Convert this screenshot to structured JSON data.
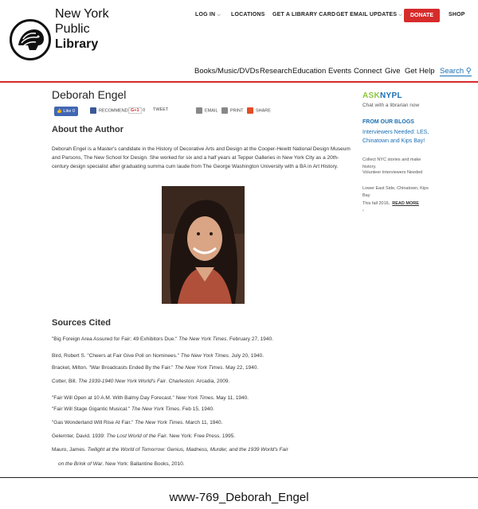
{
  "brand": {
    "line1": "New York",
    "line2": "Public",
    "line3": "Library"
  },
  "topnav": {
    "login": "LOG IN",
    "locations": "LOCATIONS",
    "library_card": "GET A LIBRARY CARD",
    "email_updates": "GET EMAIL UPDATES",
    "donate": "DONATE",
    "shop": "SHOP"
  },
  "mainnav": {
    "items": [
      "Books/Music/DVDs",
      "Research",
      "Education",
      "Events",
      "Connect",
      "Give",
      "Get Help"
    ],
    "search": "Search"
  },
  "page": {
    "title": "Deborah Engel",
    "share": {
      "like": "Like 0",
      "recommend": "RECOMMEND",
      "gplus": "G+1",
      "gplus_count": "0",
      "tweet": "TWEET",
      "email": "EMAIL",
      "print": "PRINT",
      "share": "SHARE"
    },
    "about_heading": "About the Author",
    "bio": "Deborah Engel is a Master's candidate in the History of Decorative Arts and Design at the Cooper-Hewitt National Design Museum and Parsons, The New School for Design. She worked for six and a half years at Tepper Galleries in New York City as a 20th-century design specialist after graduating summa cum laude from The George Washington University with a BA in Art History.",
    "sources_heading": "Sources Cited",
    "sources": [
      {
        "pre": "\"Big Foreign Area Assured for Fair; 49 Exhibitors Due.\" ",
        "italic": "The New York Times",
        "post": ". February 27, 1940."
      },
      {
        "pre": "Bird, Robert S. \"Cheers at Fair Give Poll on Nominees.\" ",
        "italic": "The New York Times",
        "post": ". July 20, 1940."
      },
      {
        "pre": "Bracket, Milton. \"War Broadcasts Ended By the Fair.\" ",
        "italic": "The New York Times",
        "post": ". May 22, 1940."
      },
      {
        "pre": "Cotter, Bill. ",
        "italic": "The 1939-1940 New York World's Fair",
        "post": ". Charleston: Arcadia, 2009."
      },
      {
        "pre": "\"Fair Will Open at 10 A.M. With Balmy Day Forecast.\" ",
        "italic": "New York Times",
        "post": ". May 11, 1940."
      },
      {
        "pre": "\"Fair Will Stage Gigantic Musical.\" ",
        "italic": "The New York Times",
        "post": ". Feb 15, 1940."
      },
      {
        "pre": "\"Gas Wonderland Will Rise At Fair.\" ",
        "italic": "The New York Times",
        "post": ". March 11, 1940."
      },
      {
        "pre": "Gelernter, David. 1939: ",
        "italic": "The Lost World of the Fair",
        "post": ". New York: Free Press. 1995."
      },
      {
        "pre": "Mauro, James. ",
        "italic": "Twilight at the World of Tomorrow: Genius, Madness, Murder, and the 1939 World's Fair",
        "post": ""
      },
      {
        "pre": "",
        "italic": "on the Brink of War",
        "post": ". New York: Ballantine  Books, 2010."
      }
    ]
  },
  "sidebar": {
    "ask_part1": "ASK",
    "ask_part2": "NYPL",
    "ask_sub": "Chat with a librarian now",
    "blogs_heading": "FROM OUR BLOGS",
    "blog_title": "Interviewers Needed: LES, Chinatown and Kips Bay!",
    "blog_tags": "Collect NYC stories and make history.",
    "blog_role": "Volunteer Interviewers Needed",
    "blog_locations": "Lower East Side, Chinatown, Kips Bay",
    "blog_excerpt": "This fall 2016,",
    "read_more": "READ MORE",
    "read_more_tail": "›"
  },
  "footer": {
    "caption": "www-769_Deborah_Engel"
  },
  "colors": {
    "brand_red": "#d62b2b",
    "link_blue": "#1a6fb5",
    "ask_green": "#8cc63f"
  }
}
